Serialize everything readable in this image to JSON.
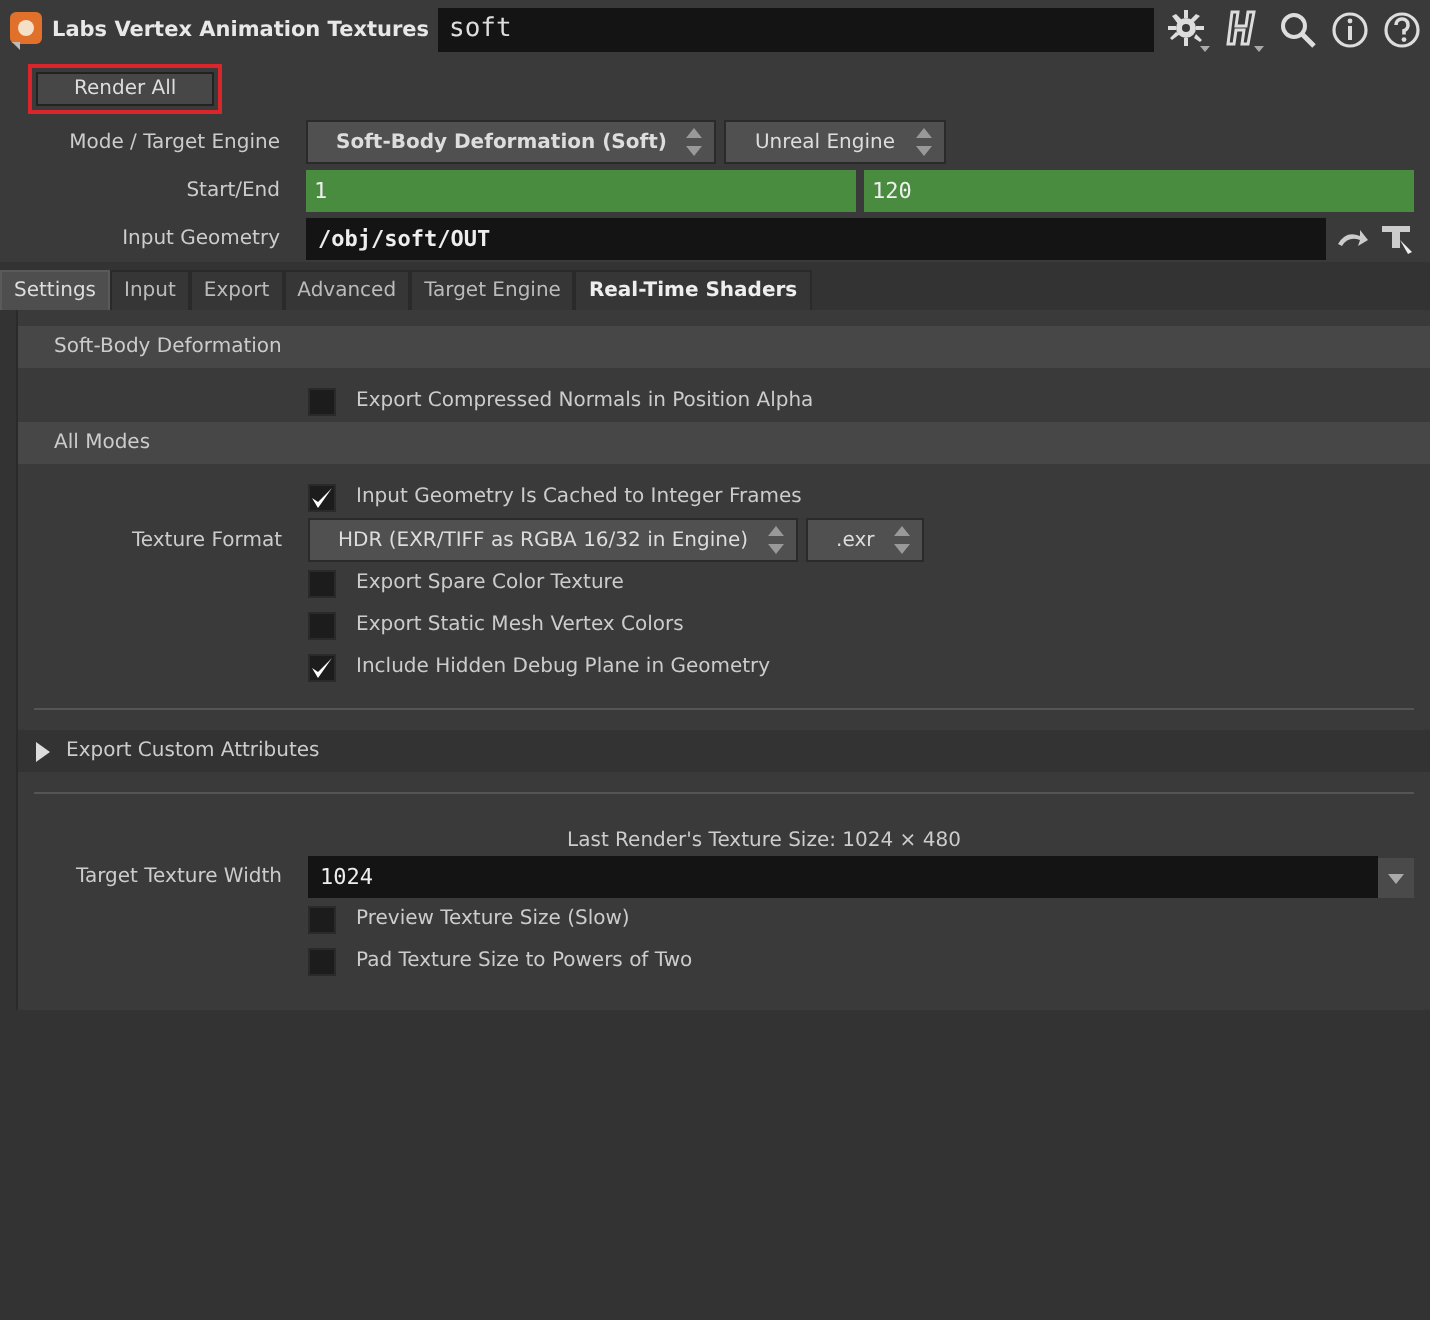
{
  "header": {
    "title": "Labs Vertex Animation Textures",
    "node_name": "soft"
  },
  "render_button": {
    "label": "Render All",
    "highlighted": true
  },
  "parameters": [
    {
      "kind": "menus",
      "label": "Mode / Target Engine",
      "menus": [
        {
          "value": "Soft-Body Deformation (Soft)",
          "bold": true
        },
        {
          "value": "Unreal Engine",
          "bold": false
        }
      ]
    },
    {
      "kind": "numbers",
      "label": "Start/End",
      "values": [
        "1",
        "120"
      ]
    },
    {
      "kind": "path",
      "label": "Input Geometry",
      "value": "/obj/soft/OUT"
    }
  ],
  "tabs": [
    {
      "label": "Settings",
      "selected": true,
      "bold": false
    },
    {
      "label": "Input",
      "selected": false,
      "bold": false
    },
    {
      "label": "Export",
      "selected": false,
      "bold": false
    },
    {
      "label": "Advanced",
      "selected": false,
      "bold": false
    },
    {
      "label": "Target Engine",
      "selected": false,
      "bold": false
    },
    {
      "label": "Real-Time Shaders",
      "selected": false,
      "bold": true
    }
  ],
  "panel": [
    {
      "kind": "heading",
      "label": "Soft-Body Deformation"
    },
    {
      "kind": "checkbox",
      "label": "Export Compressed Normals in Position Alpha",
      "checked": false
    },
    {
      "kind": "heading",
      "label": "All Modes"
    },
    {
      "kind": "checkbox",
      "label": "Input Geometry Is Cached to Integer Frames",
      "checked": true
    },
    {
      "kind": "menus",
      "label": "Texture Format",
      "menus": [
        {
          "value": "HDR (EXR/TIFF as RGBA 16/32 in Engine)",
          "bold": false
        },
        {
          "value": ".exr",
          "bold": false
        }
      ]
    },
    {
      "kind": "checkbox",
      "label": "Export Spare Color Texture",
      "checked": false
    },
    {
      "kind": "checkbox",
      "label": "Export Static Mesh Vertex Colors",
      "checked": false
    },
    {
      "kind": "checkbox",
      "label": "Include Hidden Debug Plane in Geometry",
      "checked": true
    },
    {
      "kind": "divider"
    },
    {
      "kind": "folder",
      "label": "Export Custom Attributes",
      "expanded": false
    },
    {
      "kind": "divider"
    },
    {
      "kind": "info",
      "label": "Last Render's Texture Size: 1024 × 480"
    },
    {
      "kind": "field",
      "label": "Target Texture Width",
      "value": "1024"
    },
    {
      "kind": "checkbox",
      "label": "Preview Texture Size (Slow)",
      "checked": false
    },
    {
      "kind": "checkbox",
      "label": "Pad Texture Size to Powers of Two",
      "checked": false
    }
  ]
}
